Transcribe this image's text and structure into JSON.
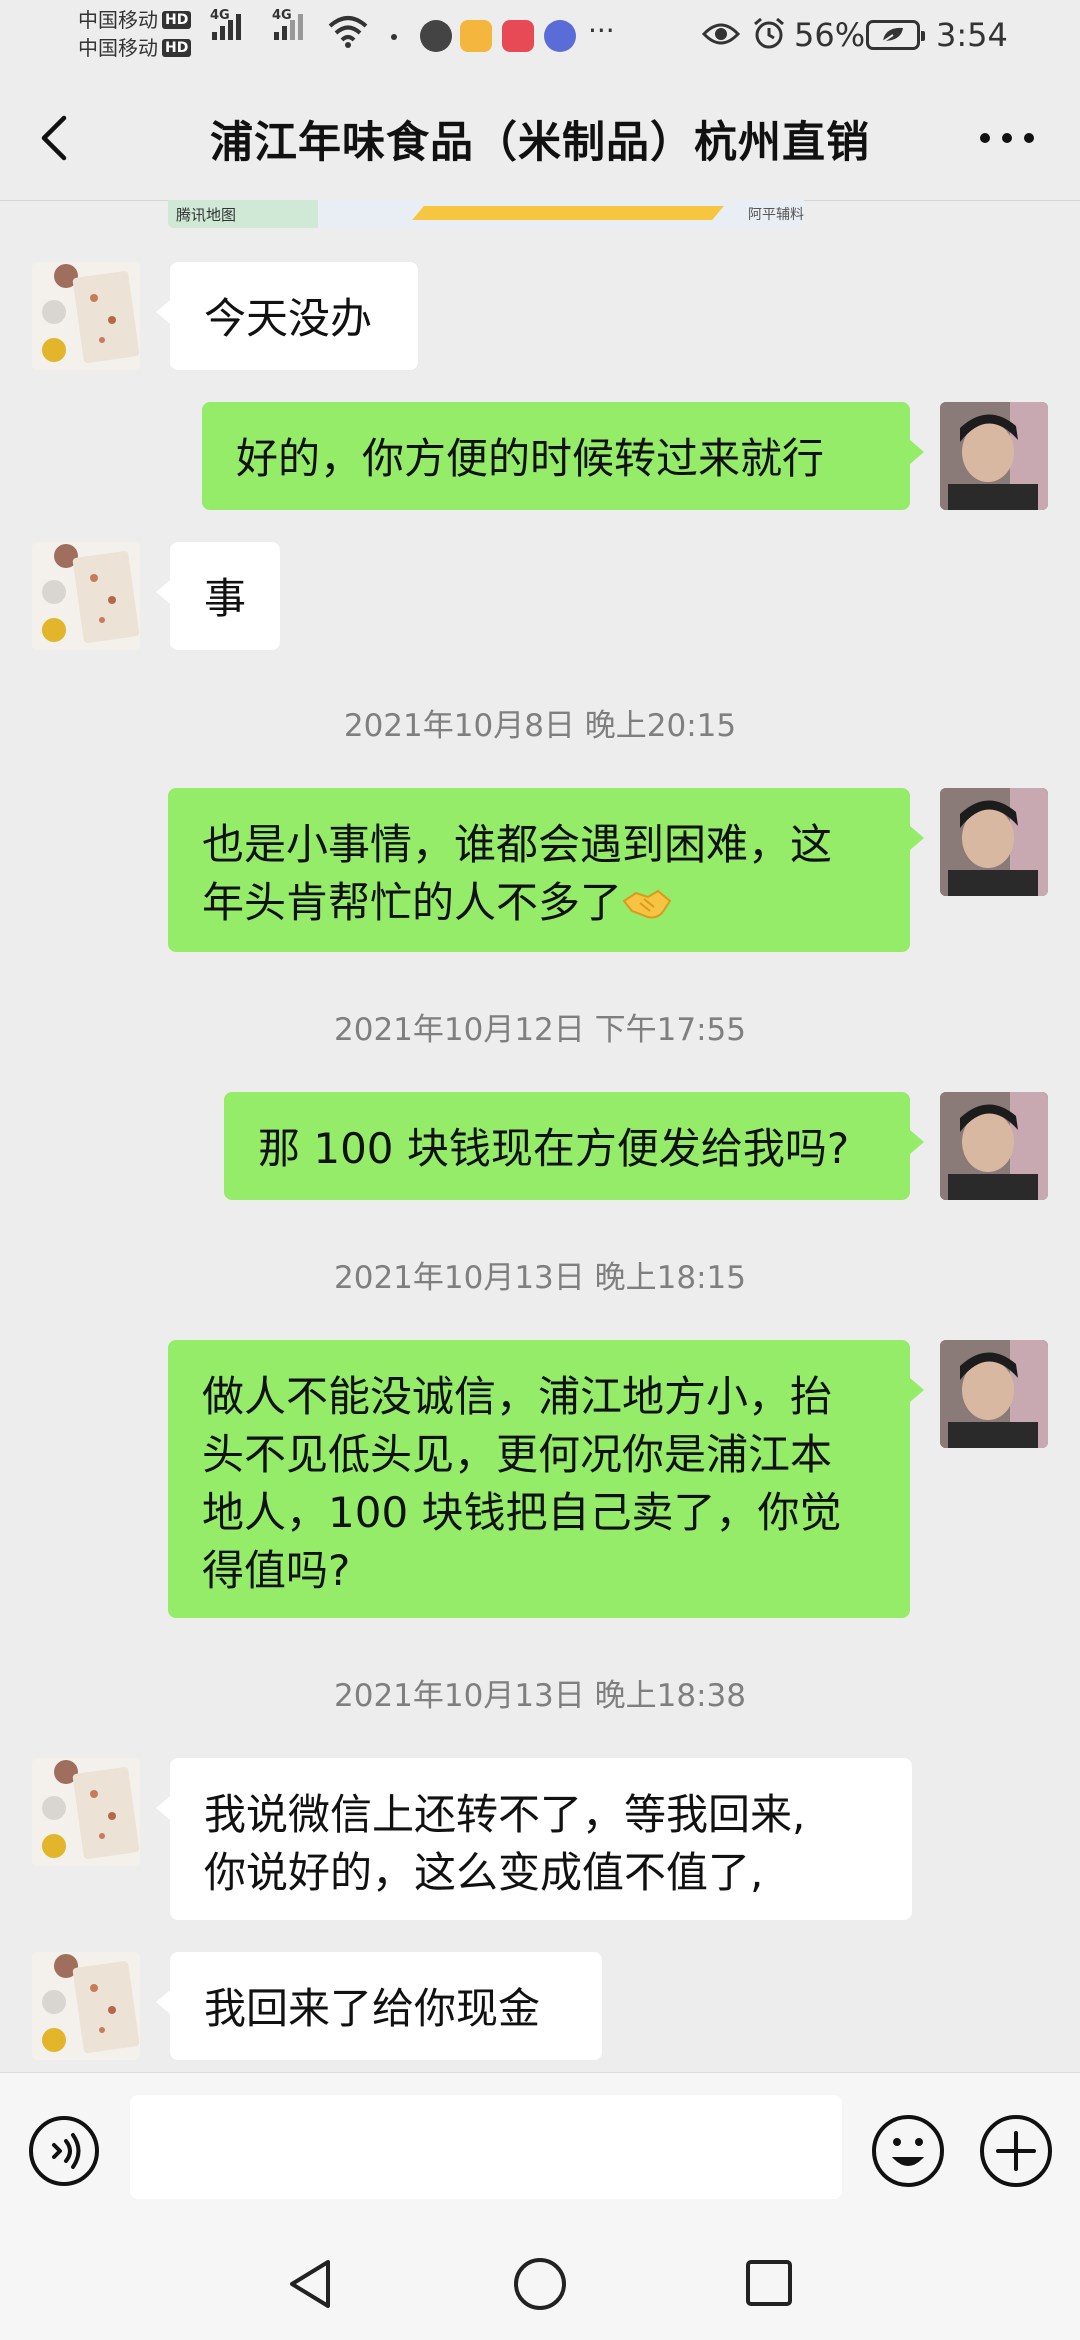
{
  "status_bar": {
    "carrier1": "中国移动",
    "carrier2": "中国移动",
    "hd_badge": "HD",
    "network_type": "4G",
    "battery": "56%",
    "time": "3:54",
    "more": "···",
    "icons": [
      "signal-icon",
      "wifi-icon",
      "app-icon",
      "eye-icon",
      "alarm-icon",
      "battery-icon"
    ]
  },
  "header": {
    "title": "浦江年味食品（米制品）杭州直销"
  },
  "map_preview": {
    "left_label": "腾讯地图",
    "right_label": "阿平辅料"
  },
  "messages": [
    {
      "sender": "contact",
      "text": "今天没办"
    },
    {
      "sender": "me",
      "text": "好的，你方便的时候转过来就行"
    },
    {
      "sender": "contact",
      "text": "事"
    },
    {
      "type": "timestamp",
      "text": "2021年10月8日 晚上20:15"
    },
    {
      "sender": "me",
      "line1": "也是小事情，谁都会遇到困难，这",
      "line2": "年头肯帮忙的人不多了",
      "emoji": "handshake-emoji"
    },
    {
      "type": "timestamp",
      "text": "2021年10月12日 下午17:55"
    },
    {
      "sender": "me",
      "text": "那 100 块钱现在方便发给我吗?"
    },
    {
      "type": "timestamp",
      "text": "2021年10月13日 晚上18:15"
    },
    {
      "sender": "me",
      "line1": "做人不能没诚信，浦江地方小，抬",
      "line2": "头不见低头见，更何况你是浦江本",
      "line3": "地人，100 块钱把自己卖了，你觉",
      "line4": "得值吗?"
    },
    {
      "type": "timestamp",
      "text": "2021年10月13日 晚上18:38"
    },
    {
      "sender": "contact",
      "line1": "我说微信上还转不了，等我回来,",
      "line2": "你说好的，这么变成值不值了,"
    },
    {
      "sender": "contact",
      "text": "我回来了给你现金"
    }
  ],
  "input_bar": {
    "placeholder": ""
  },
  "colors": {
    "background": "#ededed",
    "outgoing_bubble": "#95ec69",
    "incoming_bubble": "#ffffff",
    "timestamp_text": "#7f7f7f"
  }
}
